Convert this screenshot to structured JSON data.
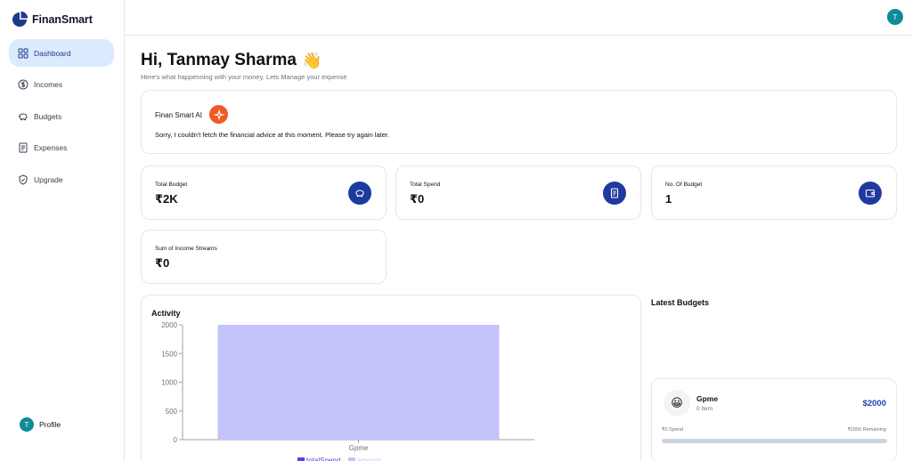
{
  "app": {
    "logo_text": "FinanSmart"
  },
  "sidebar": {
    "items": [
      {
        "label": "Dashboard",
        "icon": "grid-icon",
        "active": true
      },
      {
        "label": "Incomes",
        "icon": "dollar-circle-icon",
        "active": false
      },
      {
        "label": "Budgets",
        "icon": "piggy-bank-icon",
        "active": false
      },
      {
        "label": "Expenses",
        "icon": "receipt-icon",
        "active": false
      },
      {
        "label": "Upgrade",
        "icon": "shield-check-icon",
        "active": false
      }
    ],
    "profile": {
      "label": "Profile",
      "initial": "T"
    }
  },
  "header": {
    "avatar_initial": "T"
  },
  "greeting": {
    "title": "Hi, Tanmay Sharma",
    "emoji": "👋",
    "subtitle": "Here's what happenning with your money, Lets Manage your expense"
  },
  "ai": {
    "title": "Finan Smart AI",
    "message": "Sorry, I couldn't fetch the financial advice at this moment. Please try again later."
  },
  "stats": [
    {
      "label": "Total Budget",
      "value": "₹2K",
      "icon": "piggy-bank-icon"
    },
    {
      "label": "Total Spend",
      "value": "₹0",
      "icon": "receipt-icon"
    },
    {
      "label": "No. Of Budget",
      "value": "1",
      "icon": "wallet-icon"
    },
    {
      "label": "Sum of Income Streams",
      "value": "₹0",
      "icon": ""
    }
  ],
  "activity": {
    "title": "Activity"
  },
  "chart_data": {
    "type": "bar",
    "categories": [
      "Gpme"
    ],
    "series": [
      {
        "name": "totalSpend",
        "values": [
          0
        ],
        "color": "#4f46e5"
      },
      {
        "name": "amount",
        "values": [
          2000
        ],
        "color": "#c4c3fb"
      }
    ],
    "yticks": [
      "2000",
      "1500",
      "1000",
      "500",
      "0"
    ],
    "ylim": [
      0,
      2000
    ],
    "legend": "bottom"
  },
  "latest": {
    "title": "Latest Budgets",
    "budgets": [
      {
        "emoji": "😀",
        "name": "Gpme",
        "items": "0 Item",
        "amount": "$2000",
        "spend": "₹0 Spend",
        "remaining": "₹2000 Remaining",
        "progress": 0
      }
    ]
  }
}
